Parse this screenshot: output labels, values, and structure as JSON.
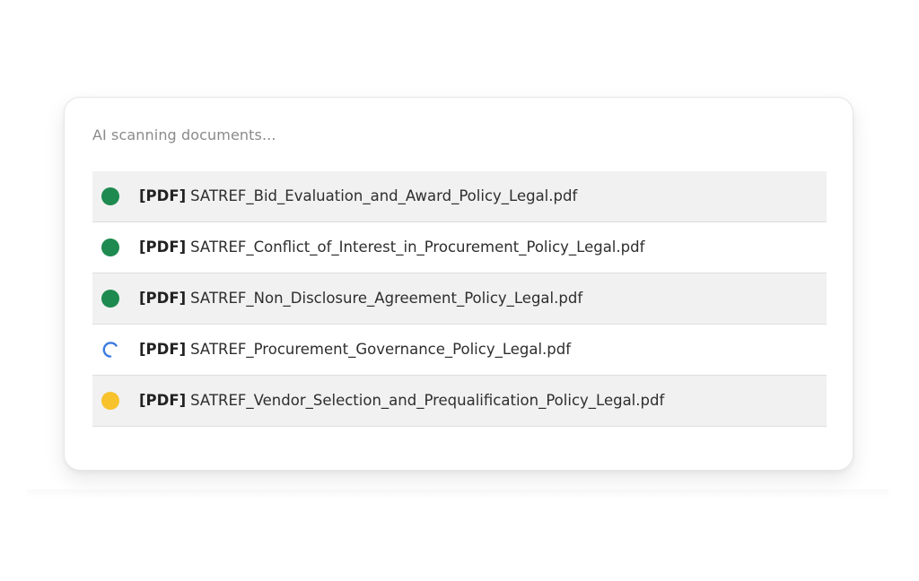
{
  "panel": {
    "title": "AI scanning documents..."
  },
  "colors": {
    "done": "#1e8a4f",
    "processing": "#3b7be0",
    "pending": "#f7c22b"
  },
  "documents": [
    {
      "tag": "[PDF]",
      "name": "SATREF_Bid_Evaluation_and_Award_Policy_Legal.pdf",
      "status": "done",
      "status_icon": "green-dot-icon"
    },
    {
      "tag": "[PDF]",
      "name": "SATREF_Conflict_of_Interest_in_Procurement_Policy_Legal.pdf",
      "status": "done",
      "status_icon": "green-dot-icon"
    },
    {
      "tag": "[PDF]",
      "name": "SATREF_Non_Disclosure_Agreement_Policy_Legal.pdf",
      "status": "done",
      "status_icon": "green-dot-icon"
    },
    {
      "tag": "[PDF]",
      "name": "SATREF_Procurement_Governance_Policy_Legal.pdf",
      "status": "processing",
      "status_icon": "spinner-icon"
    },
    {
      "tag": "[PDF]",
      "name": "SATREF_Vendor_Selection_and_Prequalification_Policy_Legal.pdf",
      "status": "pending",
      "status_icon": "yellow-dot-icon"
    }
  ]
}
